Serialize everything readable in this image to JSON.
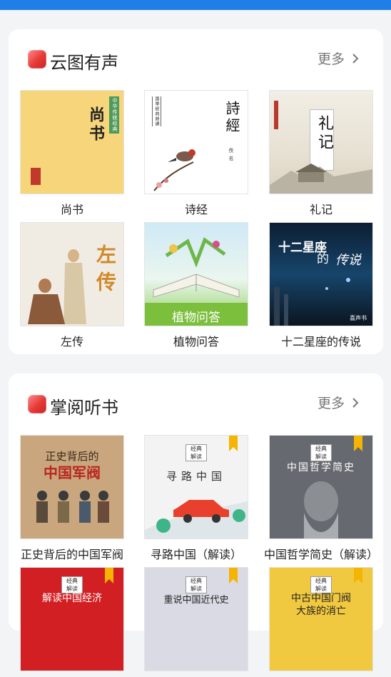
{
  "sections": [
    {
      "title": "云图有声",
      "more": "更多",
      "books": [
        {
          "title": "尚书",
          "cover_text": "尚书",
          "tag": "中华传统经典"
        },
        {
          "title": "诗经",
          "cover_text": "詩經",
          "tag": "國學經典朗讀",
          "author": "佚名"
        },
        {
          "title": "礼记",
          "cover_text": "礼记"
        },
        {
          "title": "左传",
          "cover_text": "左传"
        },
        {
          "title": "植物问答",
          "cover_text": "植物问答"
        },
        {
          "title": "十二星座的传说",
          "cover_text_a": "十二星座",
          "cover_text_b": "的",
          "cover_text_c": "传说",
          "publisher": "喜声书"
        }
      ]
    },
    {
      "title": "掌阅听书",
      "more": "更多",
      "books": [
        {
          "title": "正史背后的中国军阀",
          "cover_line1": "正史背后的",
          "cover_line2": "中国军阀"
        },
        {
          "title": "寻路中国（解读）",
          "cover_text": "寻路中国",
          "badge_top": "经典",
          "badge_bottom": "解读"
        },
        {
          "title": "中国哲学简史（解读）",
          "cover_text": "中国哲学简史",
          "badge_top": "经典",
          "badge_bottom": "解读"
        },
        {
          "title": "",
          "cover_text": "解读中国经济",
          "badge_top": "经典",
          "badge_bottom": "解读"
        },
        {
          "title": "",
          "cover_text": "重说中国近代史",
          "badge_top": "经典",
          "badge_bottom": "解读"
        },
        {
          "title": "",
          "cover_line1": "中古中国门阀",
          "cover_line2": "大族的消亡",
          "badge_top": "经典",
          "badge_bottom": "解读"
        }
      ]
    }
  ],
  "colors": {
    "accent_bar": "#1f7fe6",
    "section_icon": "#e53935",
    "background": "#f3f4f6"
  }
}
